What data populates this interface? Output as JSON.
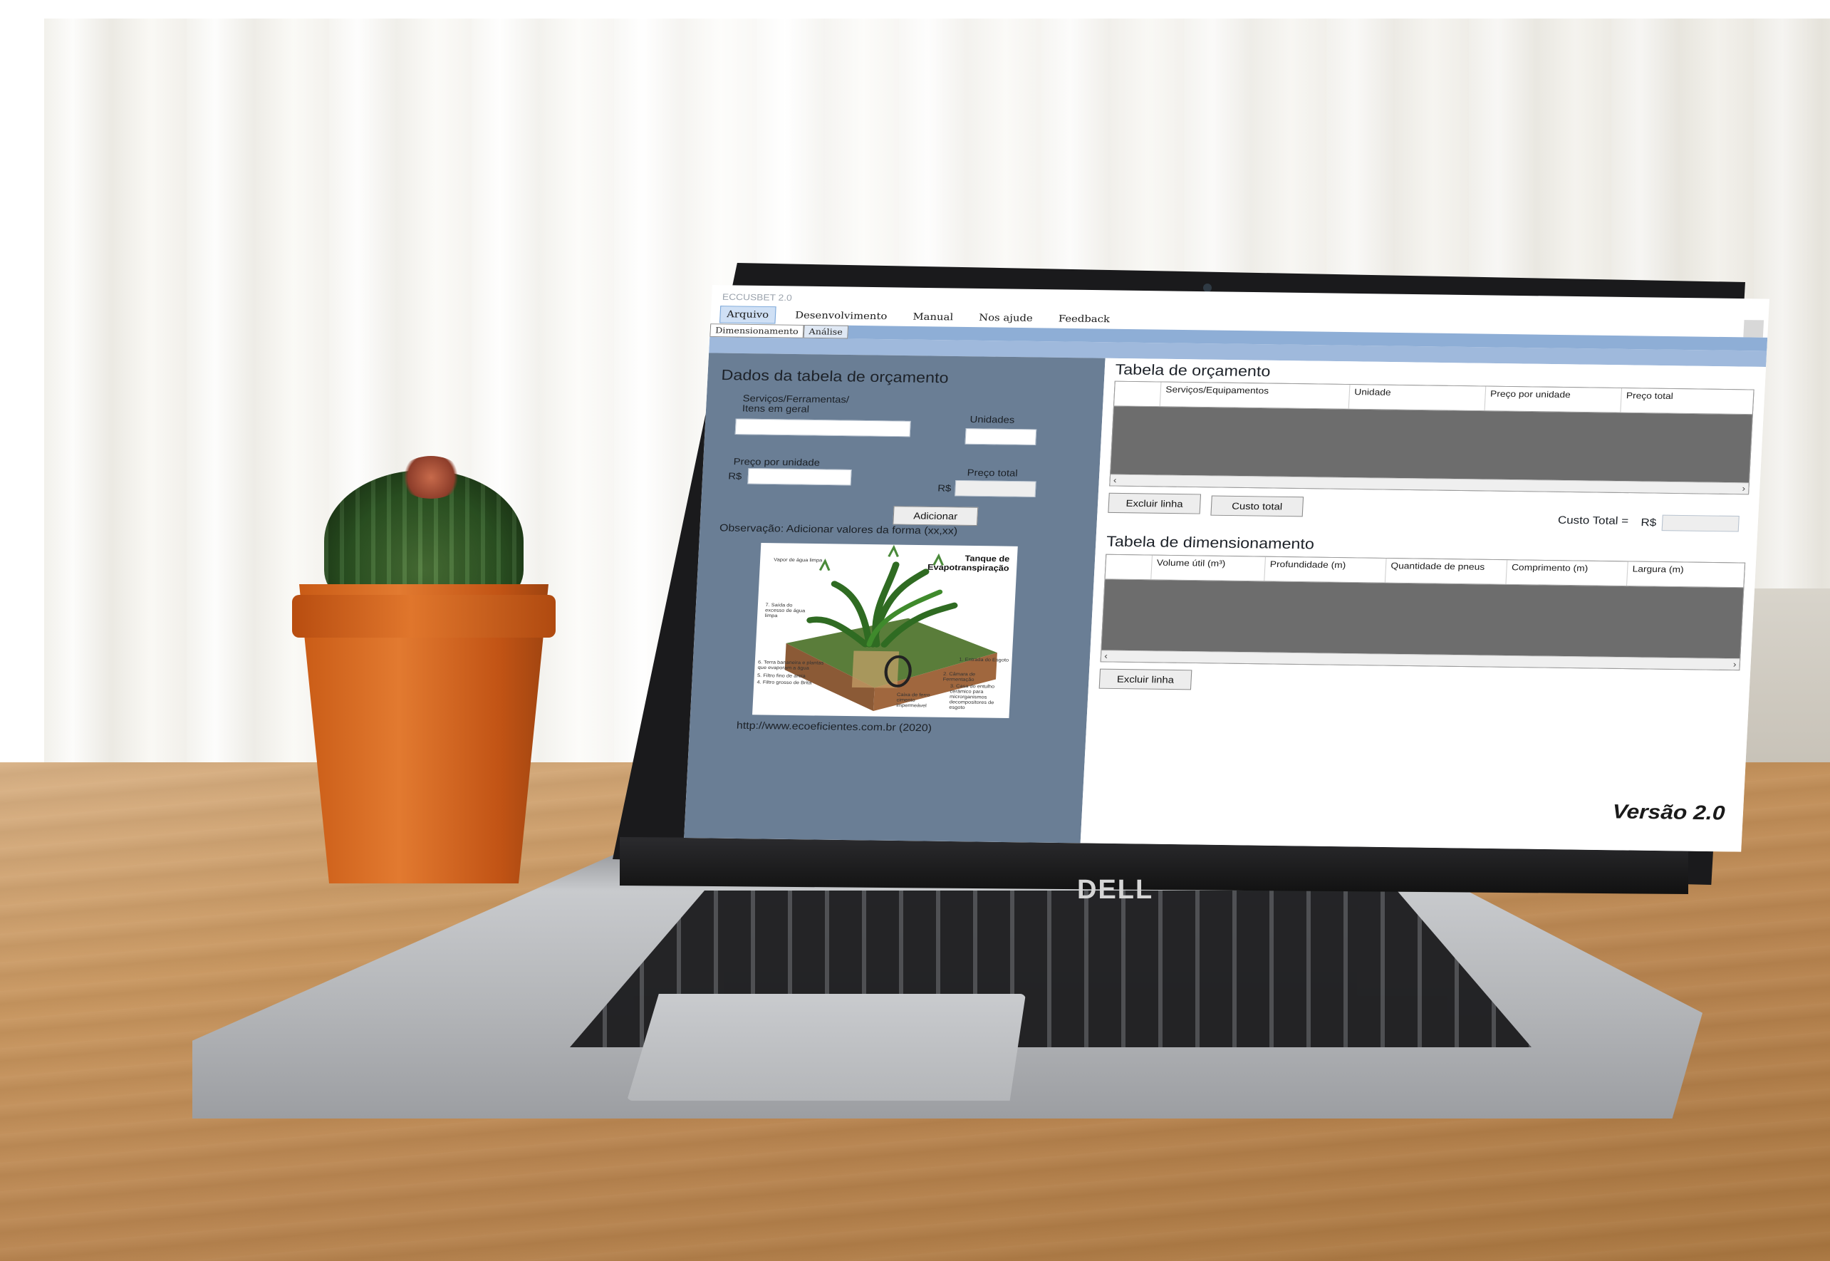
{
  "window": {
    "title": "ECCUSBET 2.0"
  },
  "menu": [
    "Arquivo",
    "Desenvolvimento",
    "Manual",
    "Nos ajude",
    "Feedback"
  ],
  "tabs": [
    "Dimensionamento",
    "Análise"
  ],
  "form": {
    "title": "Dados da tabela de orçamento",
    "servicos_label": "Serviços/Ferramentas/ Itens em geral",
    "unidades_label": "Unidades",
    "preco_unidade_label": "Preço por unidade",
    "preco_total_label": "Preço total",
    "currency": "R$",
    "add_button": "Adicionar",
    "note": "Observação: Adicionar valores da forma (xx,xx)",
    "source_url": "http://www.ecoeficientes.com.br (2020)"
  },
  "illustration": {
    "title": "Tanque de Evapotranspiração",
    "captions": [
      "Vapor de água limpa",
      "7. Saída do excesso de água limpa",
      "6. Terra bananeira e plantas que evaporam a água",
      "5. Filtro fino de areia",
      "4. Filtro grosso de Brita",
      "1. Entrada do Esgoto",
      "2. Câmara de Fermentação",
      "3. Casa do entulho cerâmico para microrganismos decompositores de esgoto",
      "Caixa de ferro cimento impermeável"
    ]
  },
  "budget_table": {
    "title": "Tabela de orçamento",
    "columns": [
      "Serviços/Equipamentos",
      "Unidade",
      "Preço por unidade",
      "Preço total"
    ],
    "delete_button": "Excluir linha",
    "total_button": "Custo total",
    "total_label": "Custo Total =",
    "currency": "R$"
  },
  "dim_table": {
    "title": "Tabela de dimensionamento",
    "columns": [
      "Volume útil (m³)",
      "Profundidade (m)",
      "Quantidade de pneus",
      "Comprimento (m)",
      "Largura (m)"
    ],
    "delete_button": "Excluir linha"
  },
  "version": "Versão 2.0",
  "laptop_brand": "DELL",
  "colors": {
    "panel": "#6a7e95",
    "grid": "#6d6d6d",
    "tab_band": "#9fb9dc",
    "active_menu": "#cfe0f5"
  }
}
